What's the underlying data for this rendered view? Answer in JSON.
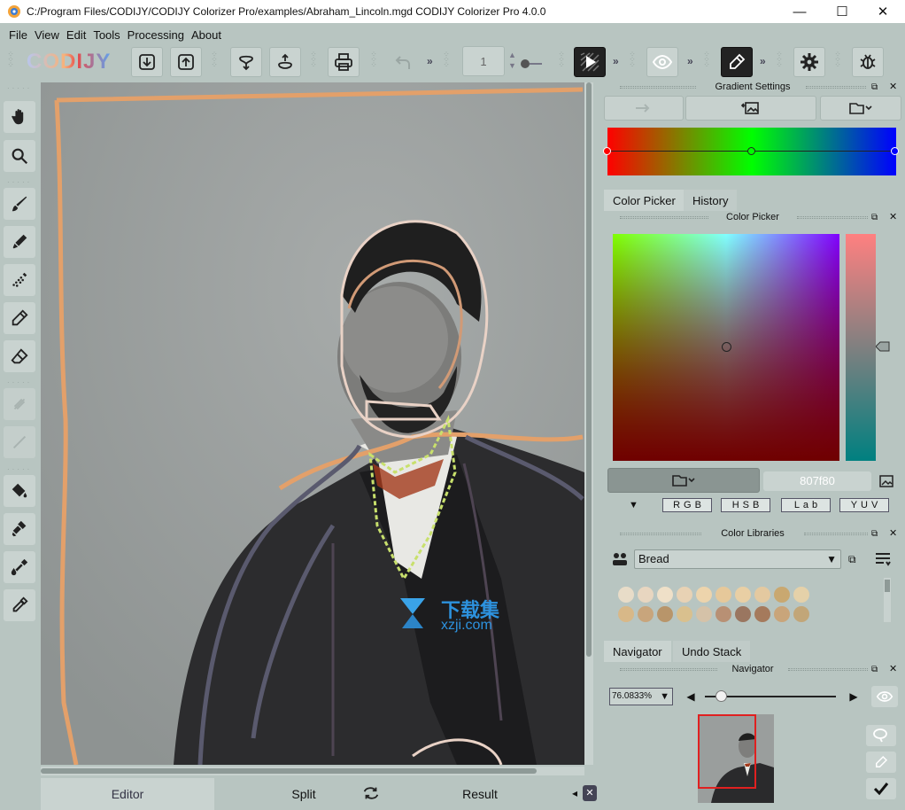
{
  "window": {
    "title": "C:/Program Files/CODIJY/CODIJY Colorizer Pro/examples/Abraham_Lincoln.mgd CODIJY Colorizer Pro 4.0.0",
    "minimize_glyph": "—",
    "maximize_glyph": "☐",
    "close_glyph": "✕"
  },
  "menu": [
    "File",
    "View",
    "Edit",
    "Tools",
    "Processing",
    "About"
  ],
  "toolbar": {
    "logo": "CODIJY",
    "frame_value": "1",
    "more_glyph": "»"
  },
  "gradient": {
    "title": "Gradient Settings",
    "stops": [
      "#ff0000",
      "#00ff00",
      "#0000ff"
    ]
  },
  "color_tabs": [
    "Color Picker",
    "History"
  ],
  "color_picker": {
    "title": "Color Picker",
    "hex_value": "807f80",
    "modes": [
      "RGB",
      "HSB",
      "Lab",
      "YUV"
    ]
  },
  "libraries": {
    "title": "Color Libraries",
    "selected": "Bread",
    "swatches": [
      "#e8dcc8",
      "#e8d6c0",
      "#efe0c8",
      "#e8d2b4",
      "#edd4ac",
      "#e6c89a",
      "#e9cfa4",
      "#e4c9a0",
      "#c9a870",
      "#e5d1a9",
      "#d8b888",
      "#c8a57c",
      "#b8956a",
      "#d9c08e",
      "#d5c2a8",
      "#b89074",
      "#9a7660",
      "#a57a5c",
      "#c9a57a",
      "#c2a678"
    ]
  },
  "nav_tabs": [
    "Navigator",
    "Undo Stack"
  ],
  "navigator": {
    "title": "Navigator",
    "zoom": "76.0833%",
    "slider_fraction": 0.08
  },
  "bottom_tabs": [
    "Editor",
    "Split",
    "Result"
  ],
  "watermark": {
    "cn": "下载集",
    "url": "xzji.com"
  }
}
